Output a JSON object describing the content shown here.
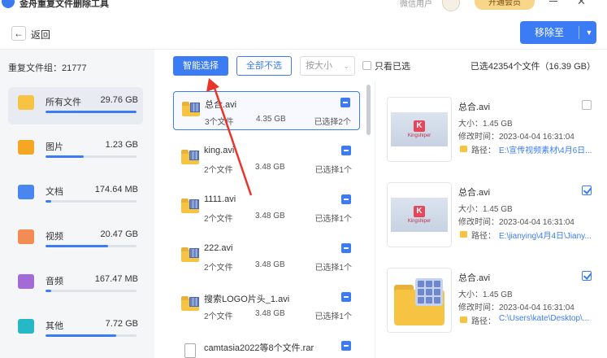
{
  "titlebar": {
    "app_title": "金舟重复文件删除工具",
    "wechat_user": "微信用户",
    "member_label": "开通会员",
    "close_glyph": "✕"
  },
  "header": {
    "back_label": "返回",
    "back_glyph": "←",
    "remove_label": "移除至",
    "remove_dropdown_glyph": "▼"
  },
  "sidebar": {
    "group_count": "重复文件组：21777",
    "items": [
      {
        "name": "所有文件",
        "size": "29.76 GB",
        "progress": 1.0,
        "color": "#f6c343"
      },
      {
        "name": "图片",
        "size": "1.23 GB",
        "progress": 0.42,
        "color": "#f5a623"
      },
      {
        "name": "文档",
        "size": "174.64 MB",
        "progress": 0.06,
        "color": "#4a86f0"
      },
      {
        "name": "视频",
        "size": "20.47 GB",
        "progress": 0.69,
        "color": "#f28b54"
      },
      {
        "name": "音频",
        "size": "167.47 MB",
        "progress": 0.06,
        "color": "#a46ad8"
      },
      {
        "name": "其他",
        "size": "7.72 GB",
        "progress": 0.78,
        "color": "#27b8c8"
      }
    ]
  },
  "toolbar": {
    "smart_select": "智能选择",
    "select_none": "全部不选",
    "sort_label": "按大小",
    "sort_chevron": "⌄",
    "only_selected": "只看已选",
    "selected_info": "已选42354个文件（16.39 GB）"
  },
  "groups": [
    {
      "name": "总合.avi",
      "count": "3个文件",
      "size": "4.35 GB",
      "selected": "已选择2个",
      "type": "video"
    },
    {
      "name": "king.avi",
      "count": "2个文件",
      "size": "3.48 GB",
      "selected": "已选择1个",
      "type": "video"
    },
    {
      "name": "1111.avi",
      "count": "2个文件",
      "size": "3.48 GB",
      "selected": "已选择1个",
      "type": "video"
    },
    {
      "name": "222.avi",
      "count": "2个文件",
      "size": "3.48 GB",
      "selected": "已选择1个",
      "type": "video"
    },
    {
      "name": "搜索LOGO片头_1.avi",
      "count": "2个文件",
      "size": "3.48 GB",
      "selected": "已选择1个",
      "type": "video"
    },
    {
      "name": "camtasia2022等8个文件.rar",
      "count": "",
      "size": "",
      "selected": "",
      "type": "doc"
    }
  ],
  "details": [
    {
      "name": "总合.avi",
      "size": "大小：1.45 GB",
      "modified": "修改时间：2023-04-04 16:31:04",
      "path_label": "路径：",
      "path": "E:\\宣传视频素材\\4月6日...",
      "checked": false,
      "thumb": "kingshiper",
      "thumb_text": "Kingshiper"
    },
    {
      "name": "总合.avi",
      "size": "大小：1.45 GB",
      "modified": "修改时间：2023-04-04 16:31:04",
      "path_label": "路径：",
      "path": "E:\\jianying\\4月4日\\Jiany...",
      "checked": true,
      "thumb": "kingshiper",
      "thumb_text": "Kingshiper"
    },
    {
      "name": "总合.avi",
      "size": "大小：1.45 GB",
      "modified": "修改时间：2023-04-04 16:31:04",
      "path_label": "路径：",
      "path": "C:\\Users\\kate\\Desktop\\...",
      "checked": true,
      "thumb": "folder",
      "thumb_text": ""
    }
  ]
}
